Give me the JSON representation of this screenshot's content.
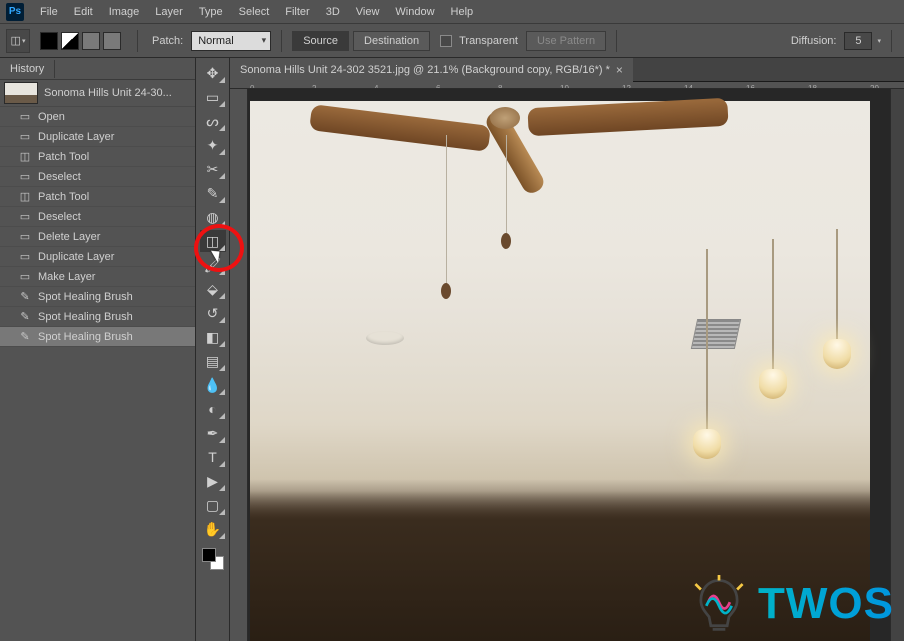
{
  "menu": {
    "items": [
      "File",
      "Edit",
      "Image",
      "Layer",
      "Type",
      "Select",
      "Filter",
      "3D",
      "View",
      "Window",
      "Help"
    ]
  },
  "options_bar": {
    "patch_label": "Patch:",
    "patch_mode": "Normal",
    "source_label": "Source",
    "destination_label": "Destination",
    "transparent_label": "Transparent",
    "use_pattern_label": "Use Pattern",
    "diffusion_label": "Diffusion:",
    "diffusion_value": "5"
  },
  "history_panel": {
    "title": "History",
    "snapshot_label": "Sonoma Hills Unit 24-30...",
    "items": [
      {
        "icon": "doc",
        "label": "Open"
      },
      {
        "icon": "doc",
        "label": "Duplicate Layer"
      },
      {
        "icon": "patch",
        "label": "Patch Tool"
      },
      {
        "icon": "doc",
        "label": "Deselect"
      },
      {
        "icon": "patch",
        "label": "Patch Tool"
      },
      {
        "icon": "doc",
        "label": "Deselect"
      },
      {
        "icon": "doc",
        "label": "Delete Layer"
      },
      {
        "icon": "doc",
        "label": "Duplicate Layer"
      },
      {
        "icon": "doc",
        "label": "Make Layer"
      },
      {
        "icon": "brush",
        "label": "Spot Healing Brush"
      },
      {
        "icon": "brush",
        "label": "Spot Healing Brush"
      },
      {
        "icon": "brush",
        "label": "Spot Healing Brush"
      }
    ],
    "active_index": 11
  },
  "tools": [
    {
      "name": "move-tool",
      "glyph": "✥"
    },
    {
      "name": "marquee-tool",
      "glyph": "▭"
    },
    {
      "name": "lasso-tool",
      "glyph": "ᔕ"
    },
    {
      "name": "magic-wand-tool",
      "glyph": "✦"
    },
    {
      "name": "crop-tool",
      "glyph": "✂"
    },
    {
      "name": "eyedropper-tool",
      "glyph": "✎"
    },
    {
      "name": "spot-healing-tool",
      "glyph": "◍"
    },
    {
      "name": "patch-tool",
      "glyph": "◫",
      "selected": true
    },
    {
      "name": "brush-tool",
      "glyph": "🖌"
    },
    {
      "name": "clone-stamp-tool",
      "glyph": "⬙"
    },
    {
      "name": "history-brush-tool",
      "glyph": "↺"
    },
    {
      "name": "eraser-tool",
      "glyph": "◧"
    },
    {
      "name": "gradient-tool",
      "glyph": "▤"
    },
    {
      "name": "blur-tool",
      "glyph": "💧"
    },
    {
      "name": "dodge-tool",
      "glyph": "◐"
    },
    {
      "name": "pen-tool",
      "glyph": "✒"
    },
    {
      "name": "type-tool",
      "glyph": "T"
    },
    {
      "name": "path-selection-tool",
      "glyph": "▶"
    },
    {
      "name": "rectangle-tool",
      "glyph": "▢"
    },
    {
      "name": "hand-tool",
      "glyph": "✋"
    }
  ],
  "document": {
    "tab_title": "Sonoma Hills Unit 24-302 3521.jpg @ 21.1% (Background copy, RGB/16*) *",
    "ruler_marks": [
      "0",
      "2",
      "4",
      "6",
      "8",
      "10",
      "12",
      "14",
      "16",
      "18",
      "20"
    ]
  },
  "watermark": {
    "text": "TWOS"
  }
}
